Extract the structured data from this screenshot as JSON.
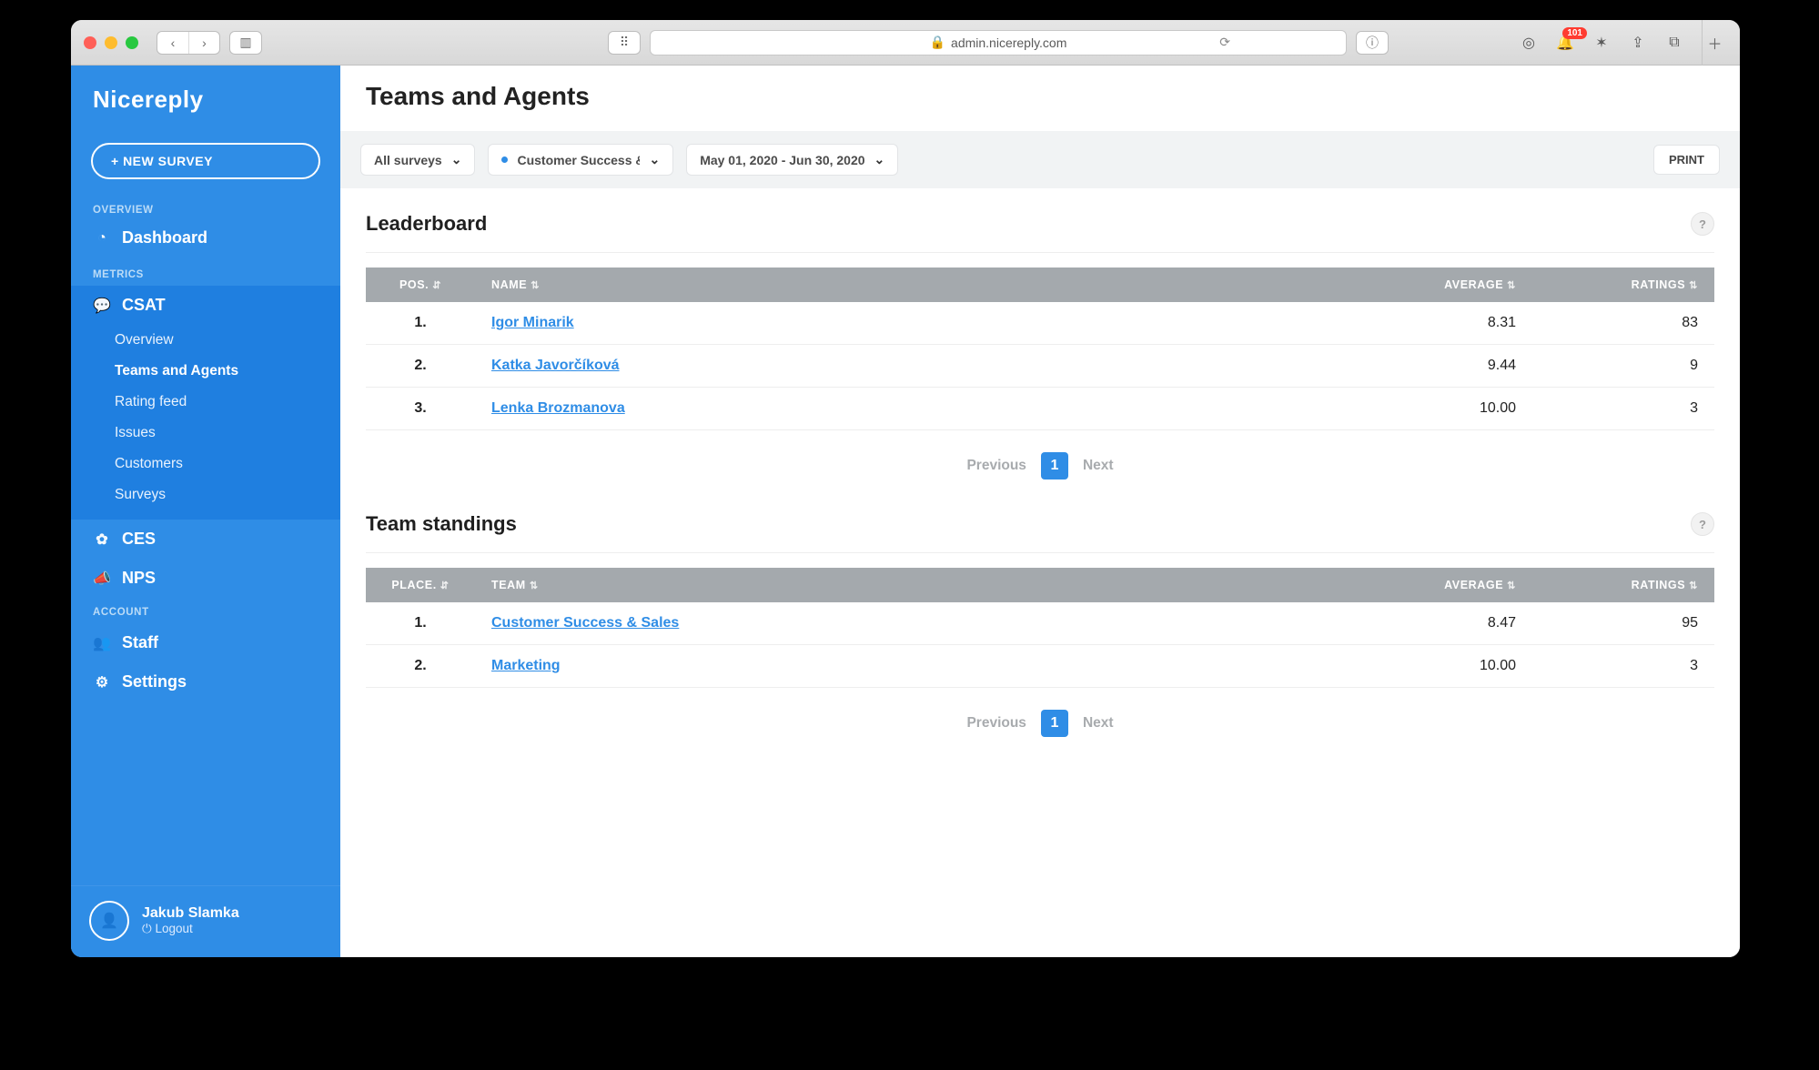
{
  "browser": {
    "url_lock": "🔒",
    "url": "admin.nicereply.com",
    "notif_count": "101"
  },
  "brand": "Nicereply",
  "new_survey": "+ NEW SURVEY",
  "sections": {
    "overview": "OVERVIEW",
    "metrics": "METRICS",
    "account": "ACCOUNT"
  },
  "nav": {
    "dashboard": "Dashboard",
    "csat": "CSAT",
    "csat_children": {
      "overview": "Overview",
      "teams_agents": "Teams and Agents",
      "rating_feed": "Rating feed",
      "issues": "Issues",
      "customers": "Customers",
      "surveys": "Surveys"
    },
    "ces": "CES",
    "nps": "NPS",
    "staff": "Staff",
    "settings": "Settings"
  },
  "user": {
    "name": "Jakub Slamka",
    "logout": "Logout"
  },
  "page": {
    "title": "Teams and Agents",
    "filters": {
      "survey": "All surveys",
      "team": "Customer Success &",
      "date": "May 01, 2020 - Jun 30, 2020"
    },
    "print": "PRINT",
    "leaderboard": {
      "title": "Leaderboard",
      "cols": {
        "pos": "POS.",
        "name": "NAME",
        "average": "AVERAGE",
        "ratings": "RATINGS"
      },
      "rows": [
        {
          "pos": "1.",
          "name": "Igor Minarik",
          "average": "8.31",
          "ratings": "83"
        },
        {
          "pos": "2.",
          "name": "Katka Javorčíková",
          "average": "9.44",
          "ratings": "9"
        },
        {
          "pos": "3.",
          "name": "Lenka Brozmanova",
          "average": "10.00",
          "ratings": "3"
        }
      ]
    },
    "team_standings": {
      "title": "Team standings",
      "cols": {
        "place": "PLACE.",
        "team": "TEAM",
        "average": "AVERAGE",
        "ratings": "RATINGS"
      },
      "rows": [
        {
          "place": "1.",
          "team": "Customer Success & Sales",
          "average": "8.47",
          "ratings": "95"
        },
        {
          "place": "2.",
          "team": "Marketing",
          "average": "10.00",
          "ratings": "3"
        }
      ]
    },
    "pagination": {
      "prev": "Previous",
      "page": "1",
      "next": "Next"
    }
  }
}
